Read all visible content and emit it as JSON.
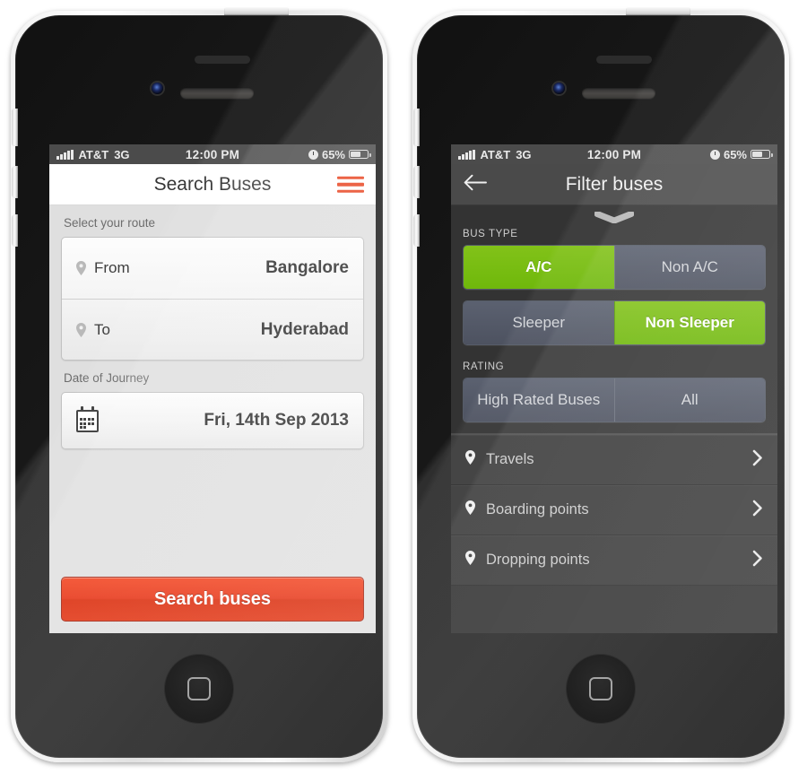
{
  "status_bar": {
    "carrier": "AT&T",
    "network": "3G",
    "time": "12:00 PM",
    "battery_percent": "65%",
    "signal_icon": "signal-bars-icon",
    "clock_icon": "alarm-clock-icon",
    "battery_icon": "battery-icon"
  },
  "left_phone": {
    "screen_name": "Search Buses",
    "nav": {
      "title": "Search Buses",
      "menu_icon": "hamburger-menu-icon",
      "menu_color": "#e8431f"
    },
    "route_section": {
      "label": "Select your route",
      "fields": [
        {
          "icon": "location-pin-icon",
          "label": "From",
          "value": "Bangalore"
        },
        {
          "icon": "location-pin-icon",
          "label": "To",
          "value": "Hyderabad"
        }
      ]
    },
    "date_section": {
      "label": "Date of Journey",
      "icon": "calendar-icon",
      "value": "Fri, 14th Sep 2013"
    },
    "primary_action": {
      "label": "Search buses",
      "color": "#e22b08"
    }
  },
  "right_phone": {
    "screen_name": "Filter buses",
    "nav": {
      "title": "Filter buses",
      "back_icon": "back-arrow-icon"
    },
    "grab_handle_icon": "chevron-down-handle-icon",
    "groups": [
      {
        "label": "BUS TYPE",
        "segments": [
          {
            "options": [
              {
                "label": "A/C",
                "selected": true
              },
              {
                "label": "Non A/C",
                "selected": false
              }
            ]
          },
          {
            "options": [
              {
                "label": "Sleeper",
                "selected": false
              },
              {
                "label": "Non Sleeper",
                "selected": true
              }
            ]
          }
        ]
      },
      {
        "label": "RATING",
        "segments": [
          {
            "options": [
              {
                "label": "High Rated Buses",
                "selected": false
              },
              {
                "label": "All",
                "selected": false
              }
            ]
          }
        ]
      }
    ],
    "list_items": [
      {
        "icon": "location-pin-icon",
        "label": "Travels",
        "chevron": "chevron-right-icon"
      },
      {
        "icon": "location-pin-icon",
        "label": "Boarding points",
        "chevron": "chevron-right-icon"
      },
      {
        "icon": "location-pin-icon",
        "label": "Dropping points",
        "chevron": "chevron-right-icon"
      }
    ],
    "accent_color": "#7bbf16",
    "inactive_color": "#545a68"
  }
}
